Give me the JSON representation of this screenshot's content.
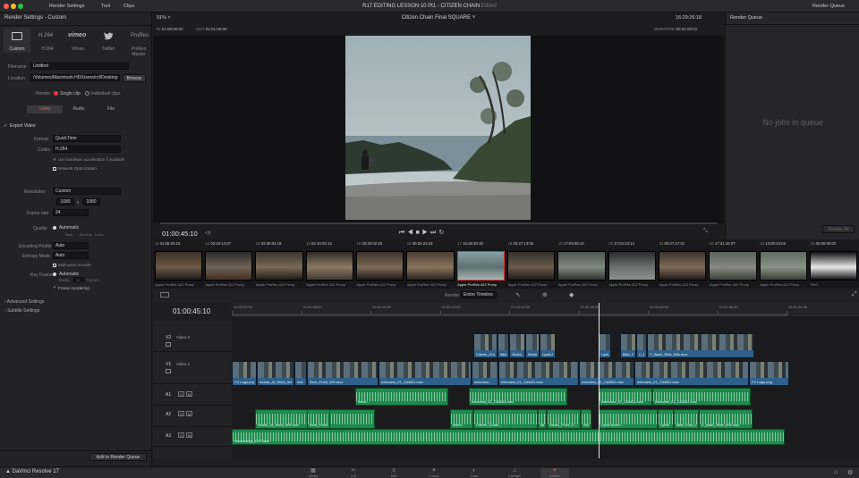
{
  "mac_bar": {
    "items": [
      "Render Settings",
      "Tool",
      "Clips"
    ],
    "title": "R17 EDITING LESSON 10 Pt1 - CITIZEN CHAIN",
    "title_suffix": "Edited",
    "right": "Render Queue"
  },
  "left_panel": {
    "title": "Render Settings - Custom",
    "presets": [
      {
        "label": "Custom",
        "icon": "custom-icon"
      },
      {
        "label": "H.264",
        "icon": "h264-icon"
      },
      {
        "label": "Vimeo",
        "icon": "vimeo-icon"
      },
      {
        "label": "Twitter",
        "icon": "twitter-icon"
      },
      {
        "label": "ProRes Master",
        "icon": "proRes-icon"
      }
    ],
    "filename_label": "Filename",
    "filename": "Untitled",
    "location_label": "Location",
    "location": "/Volumes/Macintosh HD/Users/rcf/Desktop",
    "browse": "Browse",
    "render_label": "Render",
    "render_single": "Single clip",
    "render_individual": "Individual clips",
    "tabs": [
      "Video",
      "Audio",
      "File"
    ],
    "export_video": "Export Video",
    "format_label": "Format",
    "format": "QuickTime",
    "codec_label": "Codec",
    "codec": "H.264",
    "hw_accel": "Use hardware acceleration if available",
    "network_opt": "Network Optimization",
    "resolution_label": "Resolution",
    "resolution": "Custom",
    "res_w": "1080",
    "res_h": "1080",
    "framerate_label": "Frame rate",
    "framerate": "24",
    "quality_label": "Quality",
    "quality": "Automatic",
    "quality_opts": [
      "Best",
      "Medium",
      "Least"
    ],
    "encoding_label": "Encoding Profile",
    "encoding": "Auto",
    "entropy_label": "Entropy Mode",
    "entropy": "Auto",
    "multipass": "Multi-pass encode",
    "keyframes_label": "Key Frames",
    "keyframes": "Automatic",
    "keyframes_every": "Every",
    "keyframes_val": "12",
    "keyframes_unit": "frames",
    "frame_reorder": "Frame reordering",
    "advanced": "Advanced Settings",
    "subtitle": "Subtitle Settings",
    "add_queue": "Add to Render Queue"
  },
  "viewer": {
    "zoom": "91%",
    "title": "Citizen Chain Final SQUARE",
    "timecode_right": "16:29:26:18",
    "in_label": "IN",
    "in_tc": "01:00:00:00",
    "out_label": "OUT",
    "out_tc": "01:01:00:00",
    "duration_label": "DURATION",
    "duration": "00:01:00:01",
    "tc_current": "01:00:45:10"
  },
  "queue": {
    "title": "Render Queue",
    "empty": "No jobs in queue",
    "render_all": "Render All"
  },
  "thumbs": [
    {
      "num": "11",
      "tc": "01:06:20:16",
      "name": "Apple ProRes 422 Proxy"
    },
    {
      "num": "12",
      "tc": "02:26:13:07",
      "name": "Apple ProRes 422 Proxy"
    },
    {
      "num": "13",
      "tc": "02:38:02:19",
      "name": "Apple ProRes 422 Proxy"
    },
    {
      "num": "14",
      "tc": "02:10:04:14",
      "name": "Apple ProRes 422 Proxy"
    },
    {
      "num": "15",
      "tc": "00:20:02:20",
      "name": "Apple ProRes 422 Proxy"
    },
    {
      "num": "16",
      "tc": "00:26:22:18",
      "name": "Apple ProRes 422 Proxy"
    },
    {
      "num": "17",
      "tc": "16:25:30:18",
      "name": "Apple ProRes 422 Proxy"
    },
    {
      "num": "18",
      "tc": "00:27:13:05",
      "name": "Apple ProRes 422 Proxy"
    },
    {
      "num": "19",
      "tc": "17:09:09:10",
      "name": "Apple ProRes 422 Proxy"
    },
    {
      "num": "20",
      "tc": "17:04:23:14",
      "name": "Apple ProRes 422 Proxy"
    },
    {
      "num": "21",
      "tc": "00:27:27:01",
      "name": "Apple ProRes 422 Proxy"
    },
    {
      "num": "22",
      "tc": "17:21:16:07",
      "name": "Apple ProRes 422 Proxy"
    },
    {
      "num": "23",
      "tc": "13:00:23:02",
      "name": "Apple ProRes 422 Proxy"
    },
    {
      "num": "24",
      "tc": "00:00:00:00",
      "name": "PNG"
    }
  ],
  "timeline": {
    "tc": "01:00:45:10",
    "render_label": "Render",
    "render_option": "Entire Timeline",
    "ruler": [
      "01:00:00:00",
      "01:00:08:00",
      "01:00:16:00",
      "01:00:24:00",
      "01:00:32:00",
      "01:00:40:00",
      "01:00:48:00",
      "01:00:56:00",
      "01:01:04:00"
    ],
    "tracks": [
      {
        "id": "V2",
        "name": "Video 2"
      },
      {
        "id": "V1",
        "name": "Video 1"
      },
      {
        "id": "A1",
        "name": ""
      },
      {
        "id": "A2",
        "name": ""
      },
      {
        "id": "A3",
        "name": ""
      }
    ],
    "v2_clips": [
      "Citizen_Chain...",
      "Bike_P...",
      "Gears_Front_C...",
      "Working_...",
      "Lyndi Accen...",
      "Lyndi...",
      "Bike_Foot_Cu...",
      "C_Bank_Bik...",
      "C_Bank_Ride_Wfs.mov"
    ],
    "v1_clips": [
      "FX Logo.png",
      "Actual_At_Work_Ws...",
      "Arti...",
      "Bore_Front_WS.mov",
      "Interview_01_CAM01.mov",
      "Interview...",
      "Interview_01_CAM01.mov",
      "Interview_01_CAM01.mov",
      "Interview_01_CAM01.mov",
      "FX Logo.png"
    ],
    "a1_clips": [
      "Interv...",
      "Interview_01_CAM01.mov",
      "Interview_01_CAM01.mov",
      "Interview_01_CAM01.mov"
    ],
    "a2_clips": [
      "Actual_At_Work_WS.mov",
      "Bore_Front_WS.mov",
      "Interv...",
      "Citizen_Chain...",
      "Bike_P...",
      "Gears_Front_C...",
      "Working_...",
      "Lyndi Accen...",
      "Lyndi...",
      "Bike_Foot_Cu_WS...",
      "C_Bank_Ride_WS.mov"
    ],
    "a3_clips": [
      "Hooterangs_DOT.wav"
    ]
  },
  "pages": [
    {
      "label": "Media",
      "icon": "media-icon"
    },
    {
      "label": "Cut",
      "icon": "cut-icon"
    },
    {
      "label": "Edit",
      "icon": "edit-icon"
    },
    {
      "label": "Fusion",
      "icon": "fusion-icon"
    },
    {
      "label": "Color",
      "icon": "color-icon"
    },
    {
      "label": "Fairlight",
      "icon": "fairlight-icon"
    },
    {
      "label": "Deliver",
      "icon": "deliver-icon"
    }
  ],
  "app_name": "DaVinci Resolve 17"
}
